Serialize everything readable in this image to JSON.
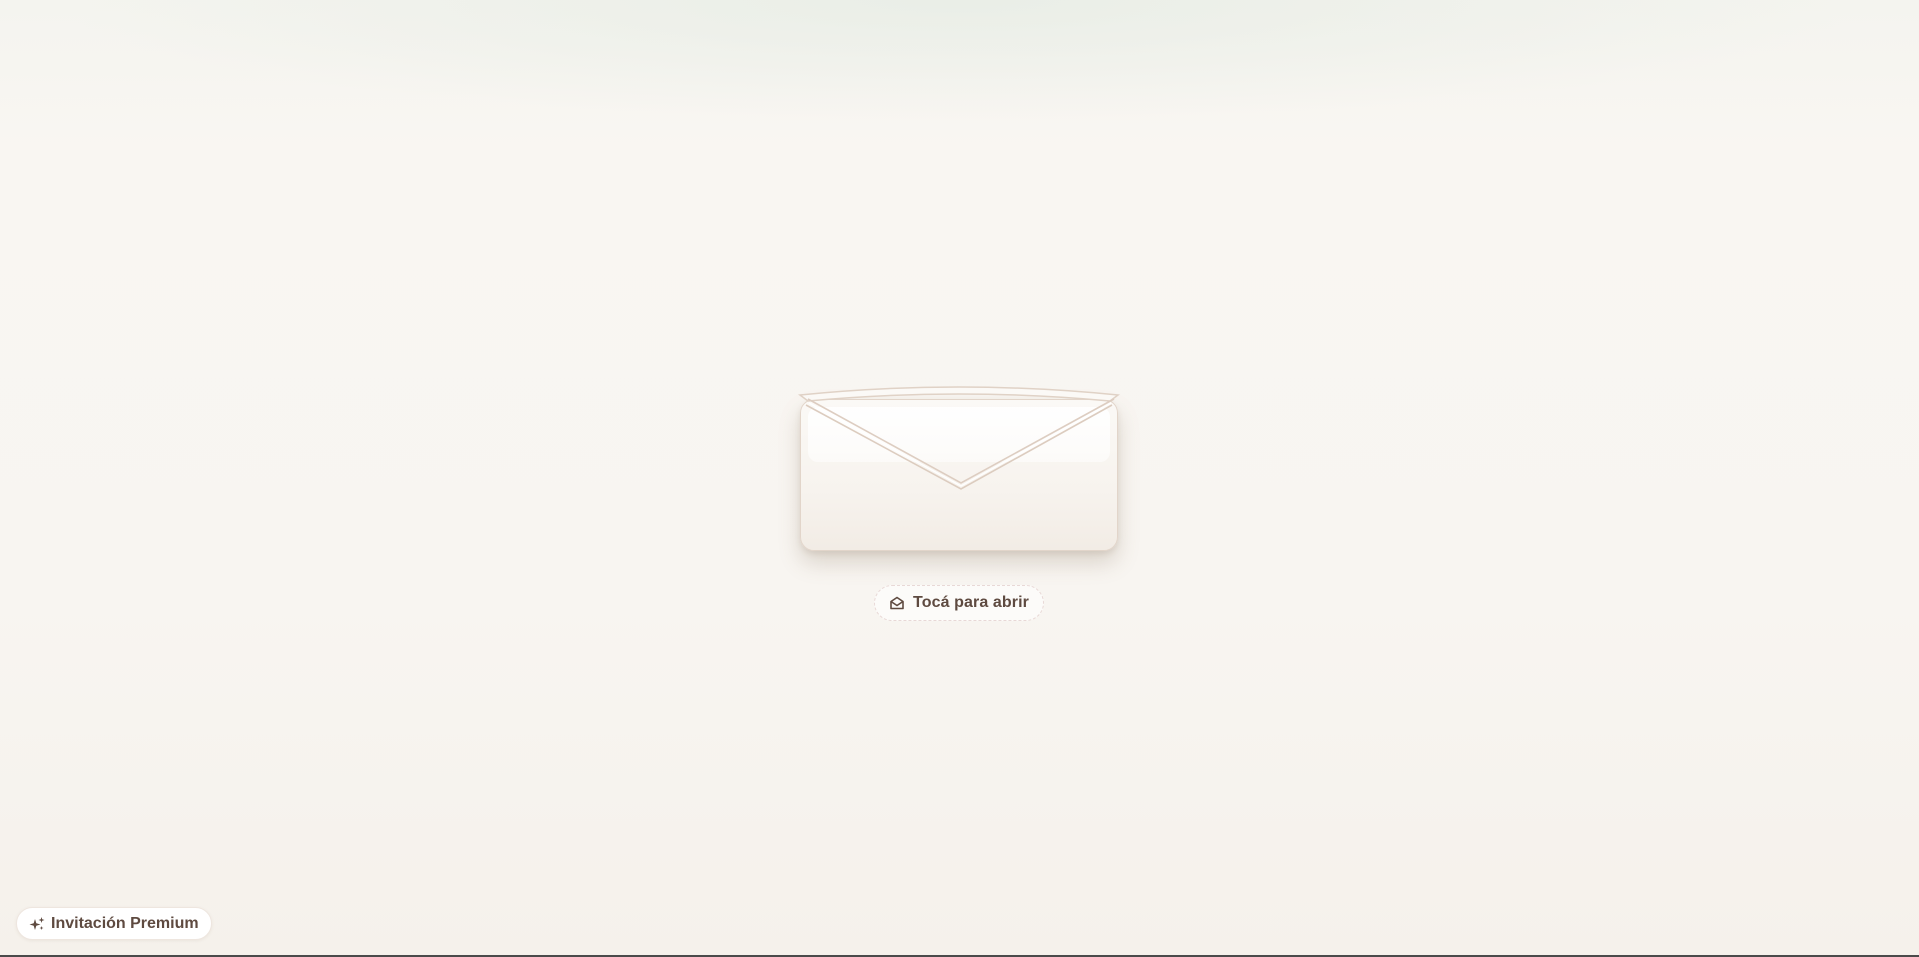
{
  "envelope": {
    "icon": "envelope-icon",
    "paper_color": "#f8f4ef",
    "border_color": "#e2d5ca"
  },
  "open_button": {
    "icon": "mail-open-icon",
    "label": "Tocá para abrir"
  },
  "premium_badge": {
    "icon": "sparkles-icon",
    "label": "Invitación Premium"
  },
  "colors": {
    "text": "#5e4a40",
    "background": "#f8f5f1"
  }
}
